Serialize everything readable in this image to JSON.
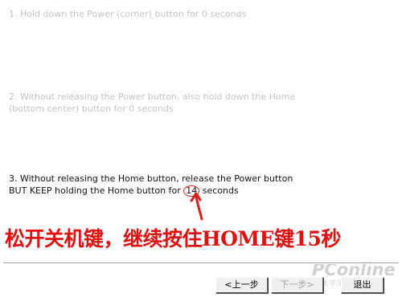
{
  "steps": [
    {
      "lines": [
        "1. Hold down the Power (corner) button for 0 seconds"
      ],
      "state": "disabled"
    },
    {
      "lines": [
        "2. Without releasing the Power button, also hold down the Home",
        "(bottom center) button for 0 seconds"
      ],
      "state": "disabled"
    },
    {
      "line1": "3. Without releasing the Home button, release the Power button",
      "line2_before": "BUT KEEP holding the Home button for ",
      "line2_count": "14",
      "line2_after": " seconds",
      "state": "active"
    }
  ],
  "annotation": {
    "text": "松开关机键，继续按住HOME键15秒",
    "color": "#e01010"
  },
  "watermark": {
    "brand": "PConline",
    "sub": "太平洋电脑网"
  },
  "buttons": {
    "back": "<上一步",
    "next": "下一步>",
    "exit": "退出"
  }
}
